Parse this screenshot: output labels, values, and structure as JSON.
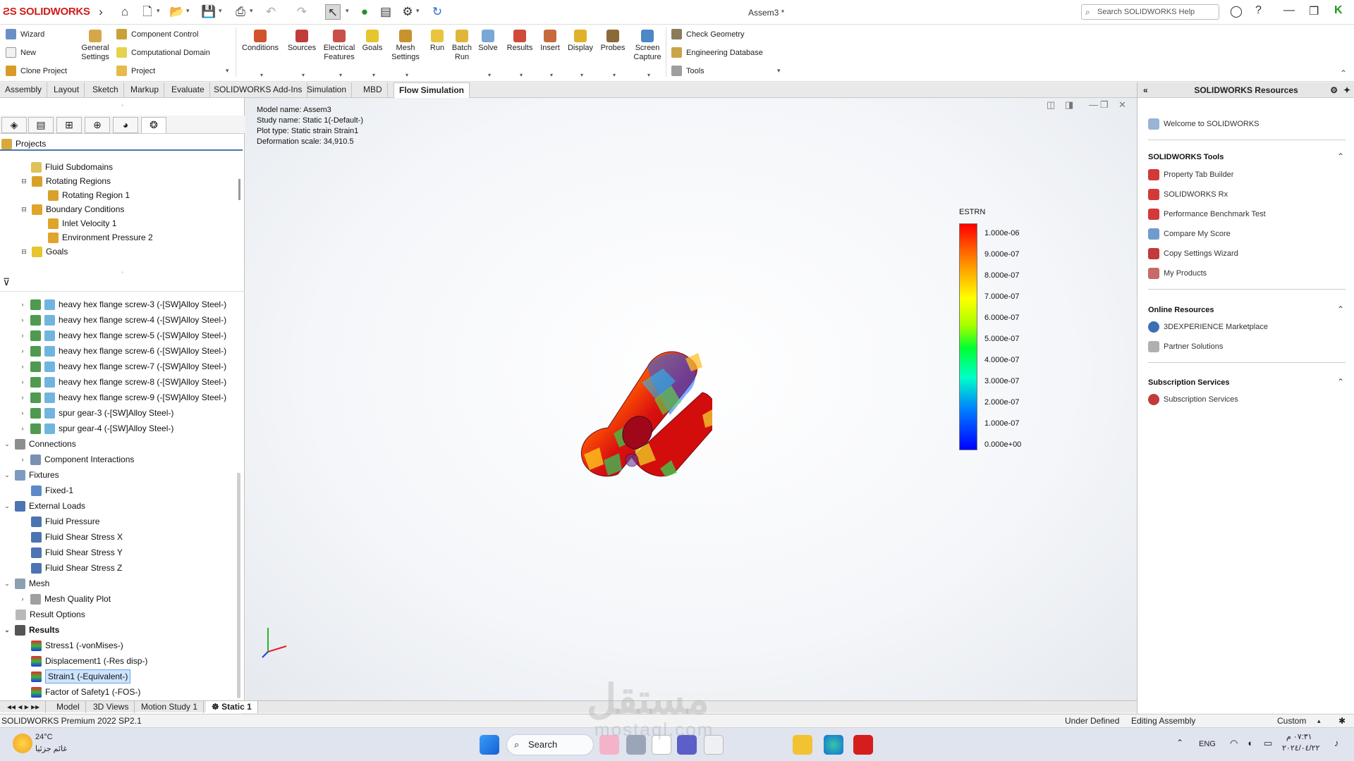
{
  "app": {
    "logo": "SOLIDWORKS",
    "doc_title": "Assem3 *",
    "search_placeholder": "Search SOLIDWORKS Help"
  },
  "command_manager": {
    "left_items": [
      "Wizard",
      "New",
      "Clone Project"
    ],
    "general_settings": "General\nSettings",
    "mid_items": [
      "Component Control",
      "Computational Domain",
      "Project"
    ],
    "big_buttons": [
      {
        "label": "Conditions"
      },
      {
        "label": "Sources"
      },
      {
        "label": "Electrical\nFeatures"
      },
      {
        "label": "Goals"
      },
      {
        "label": "Mesh\nSettings"
      },
      {
        "label": "Run"
      },
      {
        "label": "Batch\nRun"
      },
      {
        "label": "Solve"
      },
      {
        "label": "Results"
      },
      {
        "label": "Insert"
      },
      {
        "label": "Display"
      },
      {
        "label": "Probes"
      },
      {
        "label": "Screen\nCapture"
      }
    ],
    "right_items": [
      "Check Geometry",
      "Engineering Database",
      "Tools"
    ]
  },
  "tabs": [
    "Assembly",
    "Layout",
    "Sketch",
    "Markup",
    "Evaluate",
    "SOLIDWORKS Add-Ins",
    "Simulation",
    "MBD",
    "Flow Simulation"
  ],
  "flow_tree": {
    "root": "Projects",
    "items": [
      {
        "label": "Fluid Subdomains",
        "level": 1
      },
      {
        "label": "Rotating Regions",
        "level": 1
      },
      {
        "label": "Rotating Region 1",
        "level": 2
      },
      {
        "label": "Boundary Conditions",
        "level": 1
      },
      {
        "label": "Inlet Velocity 1",
        "level": 2
      },
      {
        "label": "Environment Pressure 2",
        "level": 2
      },
      {
        "label": "Goals",
        "level": 1
      }
    ]
  },
  "sim_tree": {
    "parts": [
      "heavy hex flange screw-3 (-[SW]Alloy Steel-)",
      "heavy hex flange screw-4 (-[SW]Alloy Steel-)",
      "heavy hex flange screw-5 (-[SW]Alloy Steel-)",
      "heavy hex flange screw-6 (-[SW]Alloy Steel-)",
      "heavy hex flange screw-7 (-[SW]Alloy Steel-)",
      "heavy hex flange screw-8 (-[SW]Alloy Steel-)",
      "heavy hex flange screw-9 (-[SW]Alloy Steel-)",
      "spur gear-3 (-[SW]Alloy Steel-)",
      "spur gear-4 (-[SW]Alloy Steel-)"
    ],
    "connections": "Connections",
    "component_interactions": "Component Interactions",
    "fixtures": "Fixtures",
    "fixed": "Fixed-1",
    "external_loads": "External Loads",
    "loads": [
      "Fluid Pressure",
      "Fluid Shear Stress X",
      "Fluid Shear Stress Y",
      "Fluid Shear Stress Z"
    ],
    "mesh": "Mesh",
    "mesh_quality": "Mesh Quality Plot",
    "result_options": "Result Options",
    "results": "Results",
    "result_items": [
      "Stress1 (-vonMises-)",
      "Displacement1 (-Res disp-)",
      "Strain1 (-Equivalent-)",
      "Factor of Safety1 (-FOS-)"
    ]
  },
  "bottom_tabs": [
    "Model",
    "3D Views",
    "Motion Study 1",
    "Static 1"
  ],
  "plot_info": [
    "Model name: Assem3",
    "Study name: Static 1(-Default-)",
    "Plot type: Static strain Strain1",
    "Deformation scale: 34,910.5"
  ],
  "legend": {
    "title": "ESTRN",
    "labels": [
      "1.000e-06",
      "9.000e-07",
      "8.000e-07",
      "7.000e-07",
      "6.000e-07",
      "5.000e-07",
      "4.000e-07",
      "3.000e-07",
      "2.000e-07",
      "1.000e-07",
      "0.000e+00"
    ]
  },
  "resources": {
    "title": "SOLIDWORKS Resources",
    "welcome": "Welcome to SOLIDWORKS",
    "tools_title": "SOLIDWORKS Tools",
    "tools": [
      "Property Tab Builder",
      "SOLIDWORKS Rx",
      "Performance Benchmark Test",
      "Compare My Score",
      "Copy Settings Wizard",
      "My Products"
    ],
    "online_title": "Online Resources",
    "online": [
      "3DEXPERIENCE Marketplace",
      "Partner Solutions"
    ],
    "sub_title": "Subscription Services",
    "sub": [
      "Subscription Services"
    ]
  },
  "status": {
    "left": "SOLIDWORKS Premium 2022 SP2.1",
    "state": "Under Defined",
    "mode": "Editing Assembly",
    "units": "Custom"
  },
  "taskbar": {
    "temp": "24°C",
    "weather": "غائم جزئيا",
    "search": "Search",
    "lang": "ENG",
    "time": "٠٧:٣١ م",
    "date": "٢٠٢٤/٠٤/٢٢"
  },
  "watermark": {
    "arabic": "مستقل",
    "latin": "mostaql.com"
  }
}
